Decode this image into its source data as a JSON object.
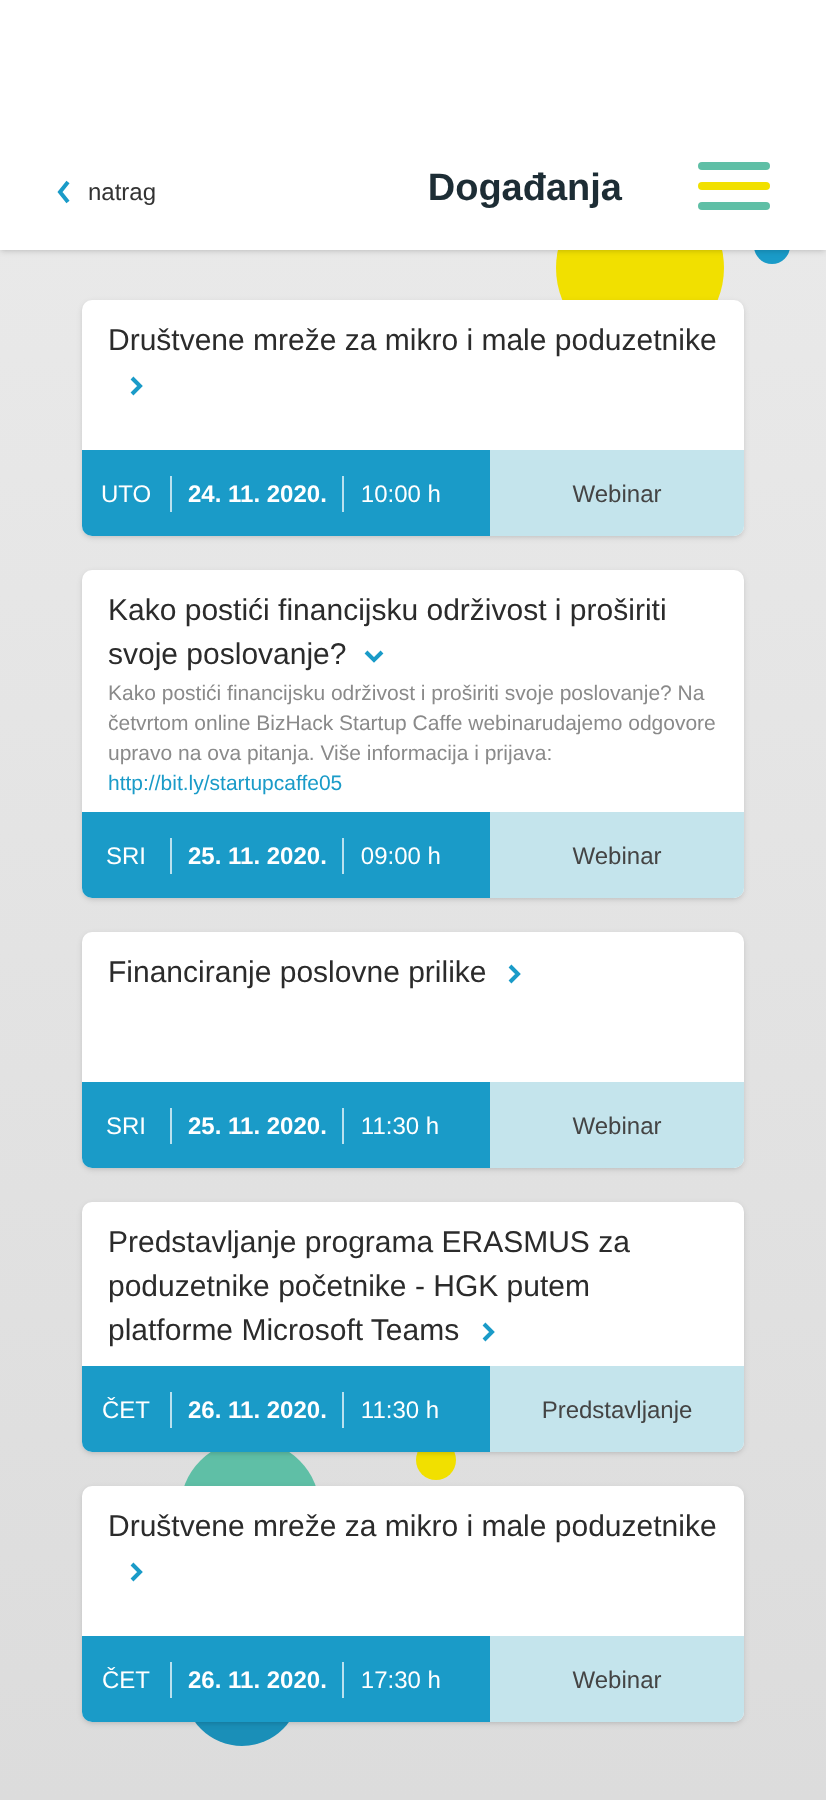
{
  "header": {
    "back_label": "natrag",
    "title": "Događanja"
  },
  "events": [
    {
      "title": "Društvene mreže za mikro i male poduzetnike",
      "expanded": false,
      "day": "UTO",
      "date": "24. 11. 2020.",
      "time": "10:00 h",
      "type": "Webinar"
    },
    {
      "title": "Kako postići financijsku održivost i proširiti svoje poslovanje?",
      "expanded": true,
      "description": "Kako postići financijsku održivost i proširiti svoje poslovanje? Na četvrtom online BizHack Startup Caffe webinarudajemo odgovore upravo na ova pitanja. Više informacija i prijava:",
      "link": "http://bit.ly/startupcaffe05",
      "day": "SRI",
      "date": "25. 11. 2020.",
      "time": "09:00 h",
      "type": "Webinar"
    },
    {
      "title": "Financiranje poslovne prilike",
      "expanded": false,
      "day": "SRI",
      "date": "25. 11. 2020.",
      "time": "11:30 h",
      "type": "Webinar"
    },
    {
      "title": "Predstavljanje programa ERASMUS za poduzetnike početnike - HGK putem platforme Microsoft Teams",
      "expanded": false,
      "day": "ČET",
      "date": "26. 11. 2020.",
      "time": "11:30 h",
      "type": "Predstavljanje"
    },
    {
      "title": "Društvene mreže za mikro i male poduzetnike",
      "expanded": false,
      "day": "ČET",
      "date": "26. 11. 2020.",
      "time": "17:30 h",
      "type": "Webinar"
    }
  ]
}
